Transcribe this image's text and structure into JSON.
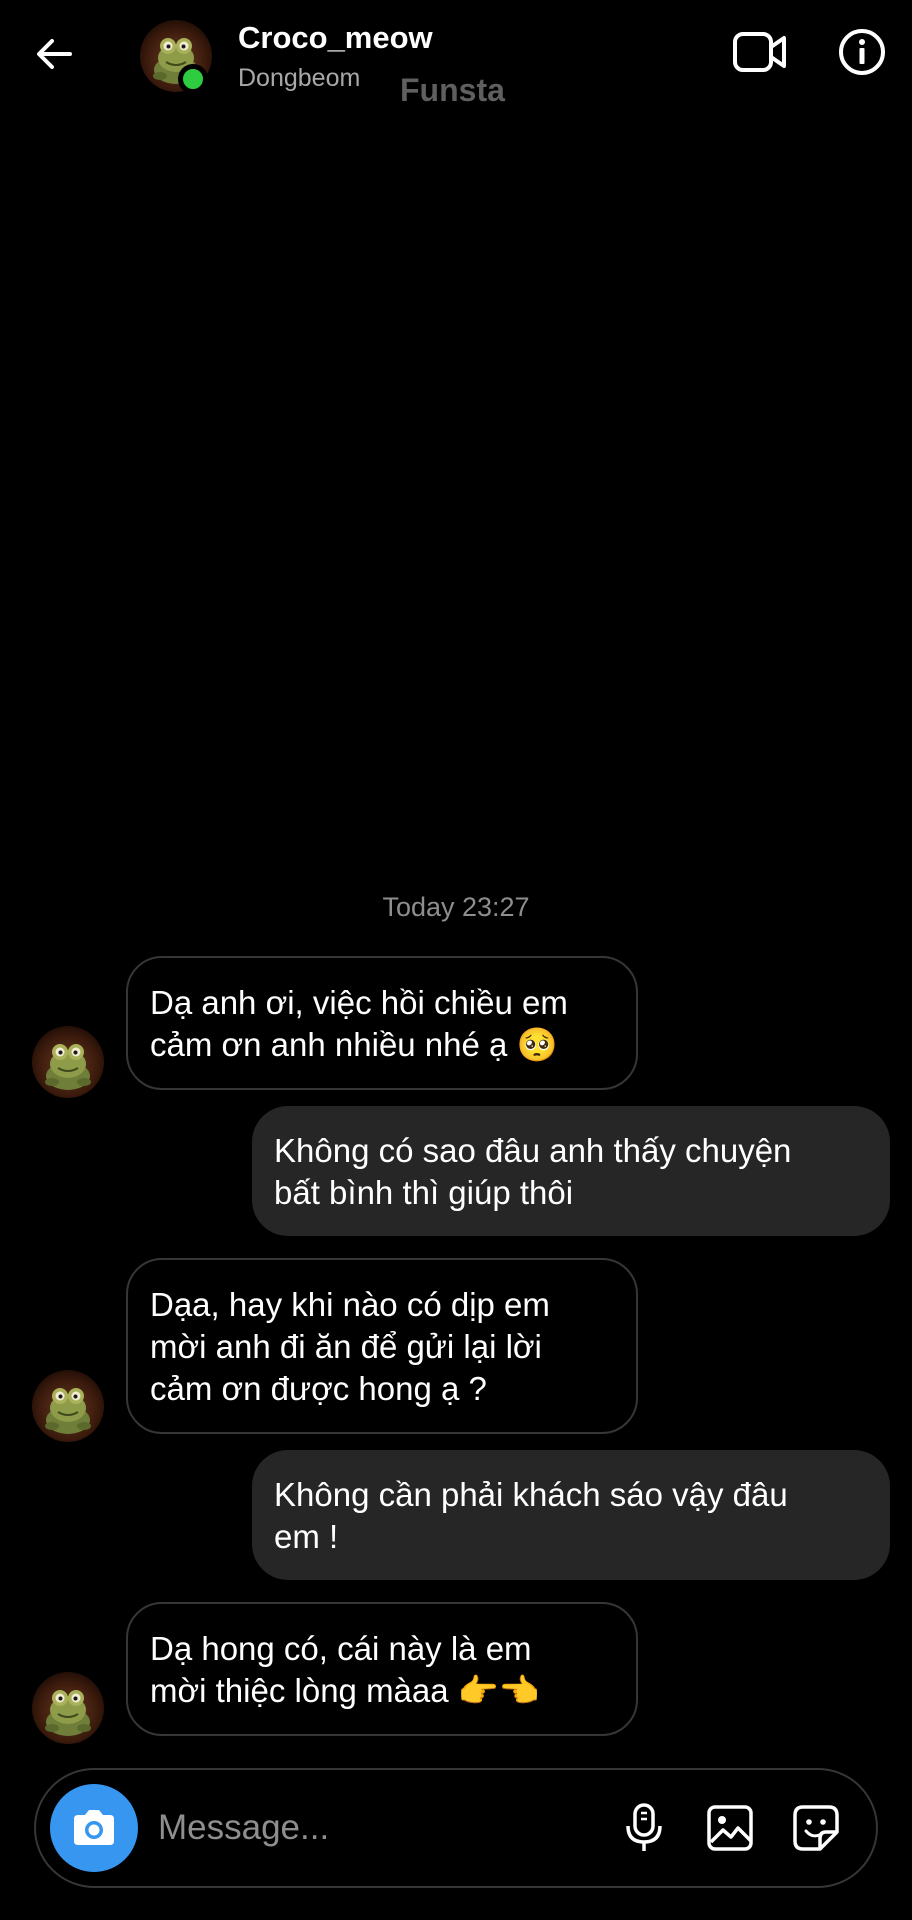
{
  "header": {
    "name": "Croco_meow",
    "subtitle": "Dongbeom",
    "watermark": "Funsta"
  },
  "timestamp": "Today 23:27",
  "messages": [
    {
      "direction": "incoming",
      "text_line1": "Dạ anh ơi, việc hồi chiều em",
      "text_line2": "cảm ơn anh nhiều nhé ạ 🥺"
    },
    {
      "direction": "outgoing",
      "text_line1": "Không có sao đâu anh thấy chuyện",
      "text_line2": "bất bình thì giúp thôi"
    },
    {
      "direction": "incoming",
      "text_line1": "Dạa, hay khi nào có dịp em",
      "text_line2": "mời anh đi ăn để gửi lại lời",
      "text_line3": "cảm ơn được hong ạ ?"
    },
    {
      "direction": "outgoing",
      "text_line1": "Không cần phải khách sáo vậy đâu",
      "text_line2": "em !"
    },
    {
      "direction": "incoming",
      "text_line1": "Dạ hong có, cái này là em",
      "text_line2": "mời thiệc lòng màaa 👉👈"
    }
  ],
  "composer": {
    "placeholder": "Message..."
  },
  "colors": {
    "background": "#000000",
    "outgoing_bubble": "#262626",
    "incoming_border": "#363636",
    "camera_button": "#3797f0",
    "online": "#2ecc40"
  },
  "icons": [
    "back-arrow-icon",
    "video-call-icon",
    "info-icon",
    "camera-icon",
    "microphone-icon",
    "gallery-icon",
    "sticker-icon"
  ]
}
